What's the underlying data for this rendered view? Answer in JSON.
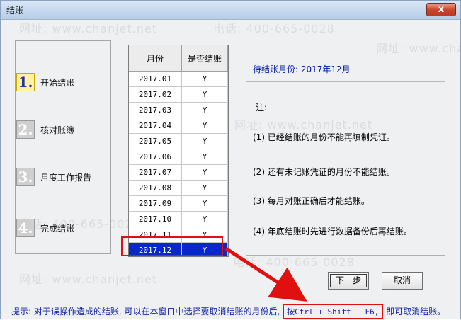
{
  "window": {
    "title": "结账",
    "close_label": "x"
  },
  "watermark": {
    "phone": "电话: 400-665-0028",
    "site": "网址: www.chanjet.net"
  },
  "steps": [
    {
      "num": "1.",
      "label": "开始结账",
      "active": true
    },
    {
      "num": "2.",
      "label": "核对账簿",
      "active": false
    },
    {
      "num": "3.",
      "label": "月度工作报告",
      "active": false
    },
    {
      "num": "4.",
      "label": "完成结账",
      "active": false
    }
  ],
  "table": {
    "headers": [
      "月份",
      "是否结账"
    ],
    "rows": [
      [
        "2017.01",
        "Y"
      ],
      [
        "2017.02",
        "Y"
      ],
      [
        "2017.03",
        "Y"
      ],
      [
        "2017.04",
        "Y"
      ],
      [
        "2017.05",
        "Y"
      ],
      [
        "2017.06",
        "Y"
      ],
      [
        "2017.07",
        "Y"
      ],
      [
        "2017.08",
        "Y"
      ],
      [
        "2017.09",
        "Y"
      ],
      [
        "2017.10",
        "Y"
      ],
      [
        "2017.11",
        "Y"
      ],
      [
        "2017.12",
        "Y"
      ]
    ],
    "selected_row": 11
  },
  "info": {
    "pending_label": "待结账月份: 2017年12月",
    "note_title": "注:",
    "notes": [
      "(1) 已经结账的月份不能再填制凭证。",
      "(2) 还有未记账凭证的月份不能结账。",
      "(3) 每月对账正确后才能结账。",
      "(4) 年底结账时先进行数据备份后再结账。"
    ]
  },
  "buttons": {
    "next": "下一步",
    "cancel": "取消"
  },
  "hint": {
    "prefix": "提示: 对于误操作造成的结账, 可以在本窗口中选择要取消结账的月份后, ",
    "key": "按Ctrl + Shift + F6,",
    "suffix": " 即可取消结账。"
  },
  "colors": {
    "selection": "#0a27c8",
    "highlight_box": "#e01010",
    "hint_text": "#1525a8"
  }
}
